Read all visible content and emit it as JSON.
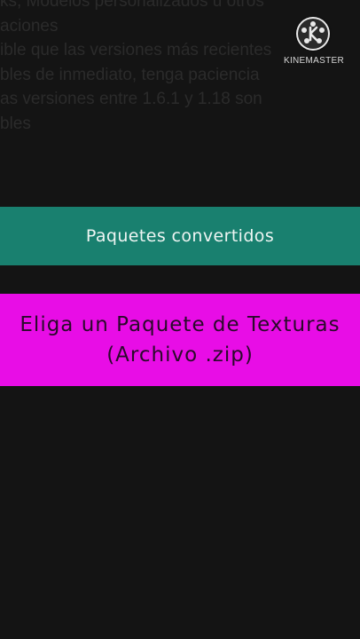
{
  "background_text": [
    "ks, Modelos personalizados u otros",
    "aciones",
    "ible que las versiones más recientes",
    "bles de inmediato, tenga paciencia",
    "as versiones entre 1.6.1 y 1.18 son",
    "bles"
  ],
  "watermark": {
    "label": "KINEMASTER",
    "icon": "kinemaster-logo-icon"
  },
  "buttons": {
    "converted_packs": "Paquetes convertidos",
    "pick_line1": "Eliga un Paquete de Texturas",
    "pick_line2": "(Archivo .zip)"
  },
  "colors": {
    "background": "#141414",
    "converted_button": "#19806f",
    "pick_button": "#e80de6"
  }
}
